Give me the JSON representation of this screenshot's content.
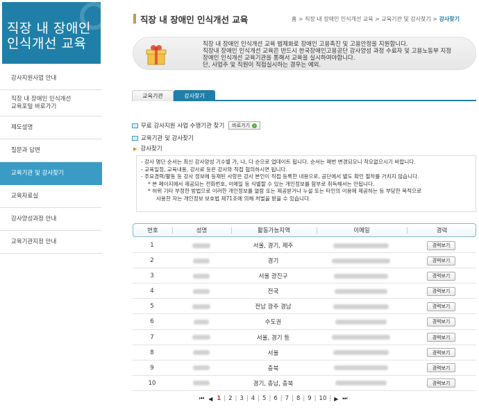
{
  "logo": {
    "line1": "직장 내 장애인",
    "line2": "인식개선  교육"
  },
  "nav": [
    "강사지원사업 안내",
    "직장 내 장애인 인식개선",
    "교육포털 바로가기",
    "제도설명",
    "질문과 답변",
    "교육기관 및 강사찾기",
    "교육자료실",
    "강사양성과정 안내",
    "교육기관지정 안내"
  ],
  "header": {
    "title": "직장 내 장애인 인식개선 교육",
    "breadcrumb": "홈 > 직장 내 장애인 인식개선 교육 > 교육기관 및 강사찾기 >",
    "breadcrumb_current": "강사찾기"
  },
  "notice": [
    "직장 내 장애인 인식개선 교육 법제화로 장애인 고용촉진 및 고용안정을 지원합니다.",
    "직장내 장애인 인식개선 교육은 반드시 한국장애인고용공단 강사양성 과정 수료자 및 고용노동부 지정",
    "장애인 인식개선 교육기관을 통해서 교육을 실시하여야합니다.",
    "단, 사업주 및 직원이 직접실시하는 경우는 예외."
  ],
  "tabs": {
    "institution": "교육기관",
    "instructor": "강사찾기"
  },
  "sections": {
    "free_support": "무료 강사지원 사업 수행기관 찾기",
    "shortcut": "바로가기",
    "org_instructor": "교육기관 및 강사찾기",
    "instructor_search": "강사찾기"
  },
  "info_lines": [
    "- 강사 명단 순서는 최신 강사양성 기수별 가, 나, 다 순으로 업데이트 됩니다. 순서는 매번 변경되오니 착오없으시기 바랍니다.",
    "- 교육일정, 교육내용, 강사료 등은 강사와 직접 협의하시면 됩니다.",
    "- 주요경력/활동 등 강사 정보에 등재된 사항은 강사 본인이 직접 등록한 내용으로, 공단에서 별도 확인 절차를 거치지 않습니다.",
    "* 본 페이지에서 제공되는 전화번호, 이메일 등 식별할 수 있는 개인정보를 함부로 취득해서는 안됩니다.",
    "* 허위 기타 부정한 방법으로 이러한 개인정보를 열람 또는 제공받거나 누설 또는 타인의 이용에 제공하는 등 부당한 목적으로",
    "사용한 자는 개인정보 보호법 제71조에 의해 처벌을 받을 수 있습니다."
  ],
  "table": {
    "headers": [
      "번호",
      "성명",
      "활동가능지역",
      "이메일",
      "경력"
    ],
    "career_button": "경력보기",
    "rows": [
      {
        "no": "1",
        "area": "서울, 경기, 제주"
      },
      {
        "no": "2",
        "area": "경기"
      },
      {
        "no": "3",
        "area": "서울 광진구"
      },
      {
        "no": "4",
        "area": "전국"
      },
      {
        "no": "5",
        "area": "전남 광주 경남"
      },
      {
        "no": "6",
        "area": "수도권"
      },
      {
        "no": "7",
        "area": "서울, 경기 등"
      },
      {
        "no": "8",
        "area": "서울"
      },
      {
        "no": "9",
        "area": "충북"
      },
      {
        "no": "10",
        "area": "경기, 충남, 충북"
      }
    ]
  },
  "pager": {
    "pages": [
      "1",
      "2",
      "3",
      "4",
      "5",
      "6",
      "7",
      "8",
      "9",
      "10"
    ],
    "current": "1"
  },
  "colors": {
    "brand": "#1f7fa8",
    "active_nav": "#3a9cc4",
    "accent": "#c29a55"
  }
}
